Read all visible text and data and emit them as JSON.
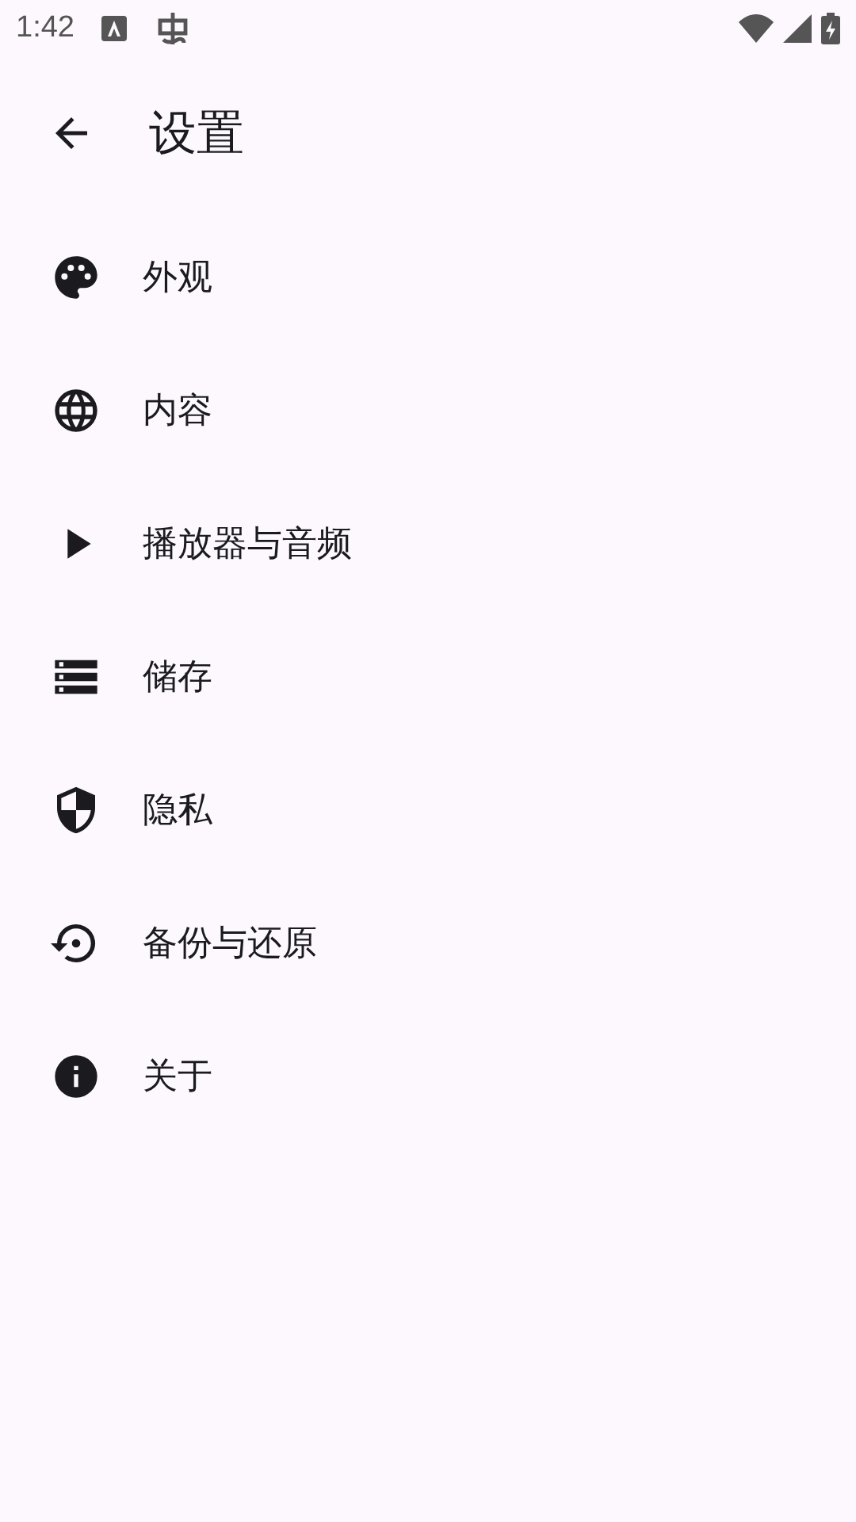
{
  "status_bar": {
    "time": "1:42"
  },
  "app_bar": {
    "title": "设置"
  },
  "items": [
    {
      "kind": "palette",
      "label": "外观"
    },
    {
      "kind": "globe",
      "label": "内容"
    },
    {
      "kind": "play",
      "label": "播放器与音频"
    },
    {
      "kind": "storage",
      "label": "储存"
    },
    {
      "kind": "shield",
      "label": "隐私"
    },
    {
      "kind": "restore",
      "label": "备份与还原"
    },
    {
      "kind": "info",
      "label": "关于"
    }
  ]
}
